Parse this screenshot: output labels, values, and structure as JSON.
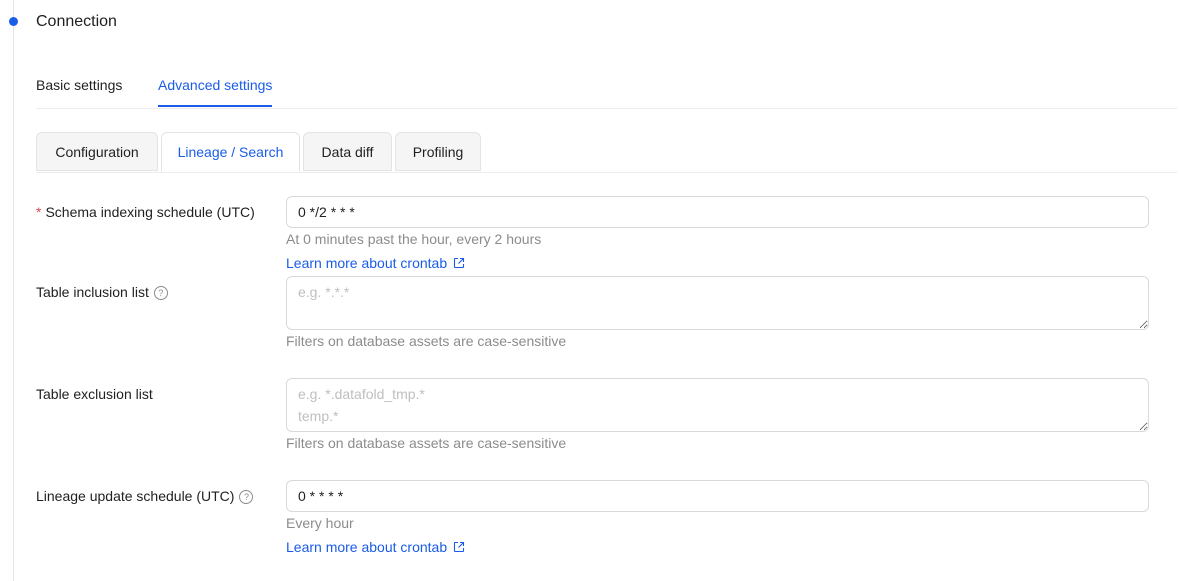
{
  "section": {
    "title": "Connection"
  },
  "main_tabs": [
    {
      "label": "Basic settings",
      "active": false
    },
    {
      "label": "Advanced settings",
      "active": true
    }
  ],
  "sub_tabs": [
    {
      "label": "Configuration",
      "active": false
    },
    {
      "label": "Lineage / Search",
      "active": true
    },
    {
      "label": "Data diff",
      "active": false
    },
    {
      "label": "Profiling",
      "active": false
    }
  ],
  "form": {
    "schema_schedule": {
      "required_mark": "*",
      "label": "Schema indexing schedule (UTC)",
      "value": "0 */2 * * *",
      "description": "At 0 minutes past the hour, every 2 hours",
      "link": "Learn more about crontab"
    },
    "inclusion": {
      "label": "Table inclusion list",
      "placeholder": "e.g. *.*.*",
      "hint": "Filters on database assets are case-sensitive"
    },
    "exclusion": {
      "label": "Table exclusion list",
      "placeholder": "e.g. *.datafold_tmp.*\ntemp.*",
      "hint": "Filters on database assets are case-sensitive"
    },
    "lineage_schedule": {
      "label": "Lineage update schedule (UTC)",
      "value": "0 * * * *",
      "description": "Every hour",
      "link": "Learn more about crontab"
    }
  },
  "icons": {
    "help": "question-circle-icon",
    "external": "external-link-icon",
    "timeline_dot": "step-dot"
  },
  "colors": {
    "accent": "#1a5ce8",
    "required": "#e5484d",
    "muted_text": "#8c8c8c",
    "border": "#d9d9d9"
  }
}
